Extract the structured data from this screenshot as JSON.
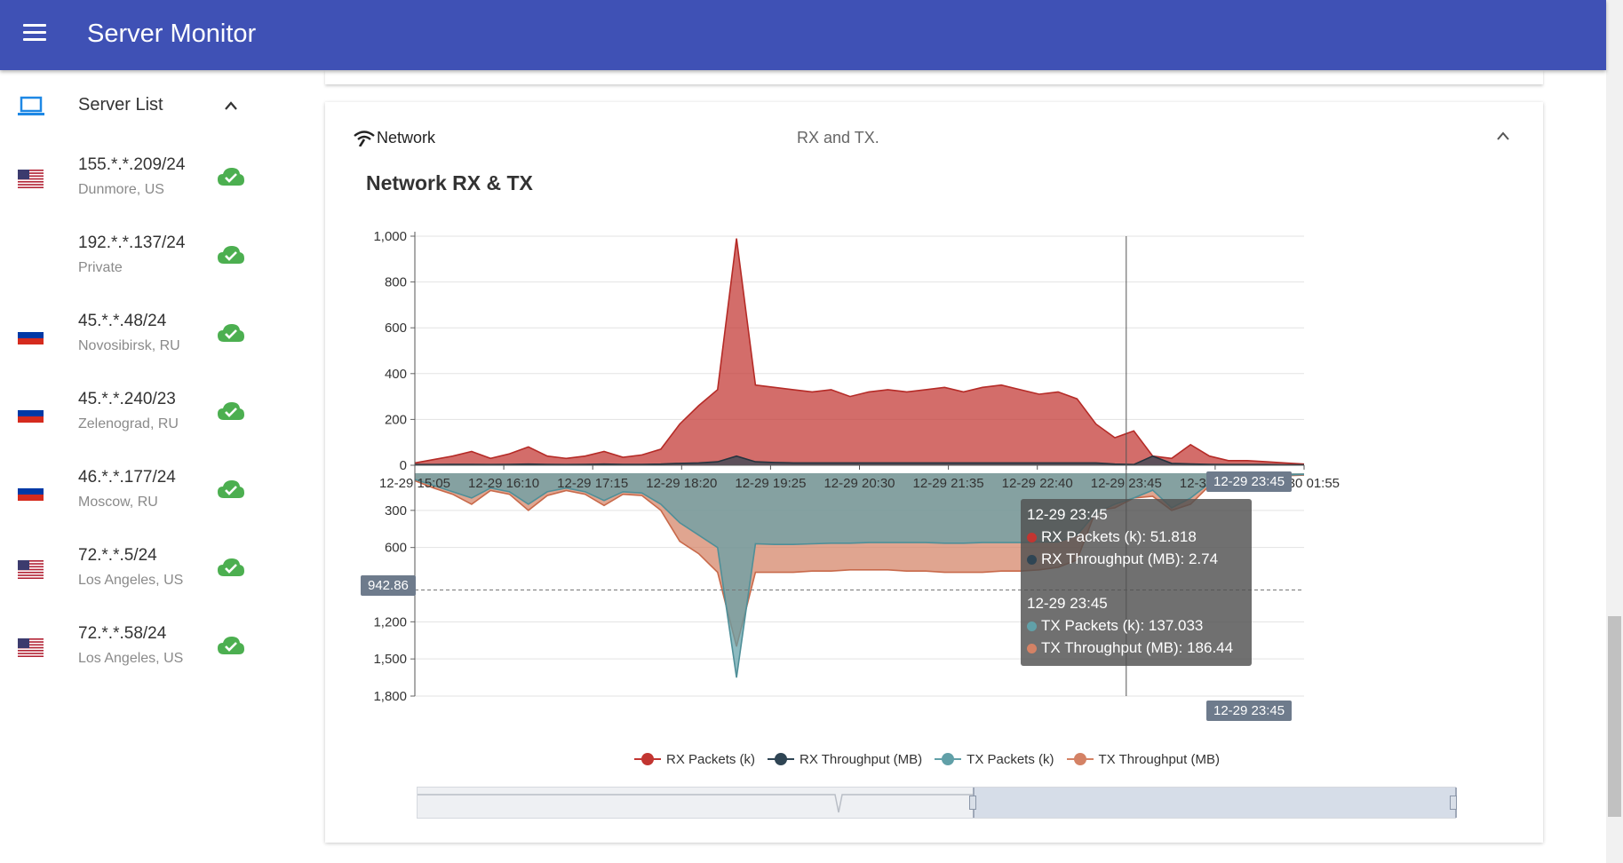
{
  "app": {
    "title": "Server Monitor"
  },
  "sidebar": {
    "header_label": "Server List",
    "servers": [
      {
        "ip": "155.*.*.209/24",
        "location": "Dunmore, US",
        "flag": "us",
        "status": "online"
      },
      {
        "ip": "192.*.*.137/24",
        "location": "Private",
        "flag": "none",
        "status": "online"
      },
      {
        "ip": "45.*.*.48/24",
        "location": "Novosibirsk, RU",
        "flag": "ru",
        "status": "online"
      },
      {
        "ip": "45.*.*.240/23",
        "location": "Zelenograd, RU",
        "flag": "ru",
        "status": "online"
      },
      {
        "ip": "46.*.*.177/24",
        "location": "Moscow, RU",
        "flag": "ru",
        "status": "online"
      },
      {
        "ip": "72.*.*.5/24",
        "location": "Los Angeles, US",
        "flag": "us",
        "status": "online"
      },
      {
        "ip": "72.*.*.58/24",
        "location": "Los Angeles, US",
        "flag": "us",
        "status": "online"
      }
    ]
  },
  "card": {
    "title": "Network",
    "subtitle": "RX and TX.",
    "chart_title": "Network RX & TX"
  },
  "tooltip": {
    "group1_time": "12-29 23:45",
    "rx_packets": "RX Packets (k): 51.818",
    "rx_throughput": "RX Throughput (MB): 2.74",
    "group2_time": "12-29 23:45",
    "tx_packets": "TX Packets (k): 137.033",
    "tx_throughput": "TX Throughput (MB): 186.44"
  },
  "axis_pointer": {
    "x_label_top": "12-29 23:45",
    "x_label_bottom": "12-29 23:45",
    "y_label": "942.86"
  },
  "legend": [
    "RX Packets (k)",
    "RX Throughput (MB)",
    "TX Packets (k)",
    "TX Throughput (MB)"
  ],
  "colors": {
    "accent": "#3f51b5",
    "rx_packets": "#c23531",
    "rx_throughput": "#2f4554",
    "tx_packets": "#61a0a8",
    "tx_throughput": "#d48265",
    "online": "#4caf50"
  },
  "chart_data": {
    "type": "area",
    "title": "Network RX & TX",
    "x": [
      "12-29 15:05",
      "12-29 16:10",
      "12-29 17:15",
      "12-29 18:20",
      "12-29 19:25",
      "12-29 20:30",
      "12-29 21:35",
      "12-29 22:40",
      "12-29 23:45",
      "12-30 00:50",
      "12-30 01:55"
    ],
    "x_tick_labels": [
      "12-29 15:05",
      "12-29 16:10",
      "12-29 17:15",
      "12-29 18:20",
      "12-29 19:25",
      "12-29 20:30",
      "12-29 21:35",
      "12-29 22:40",
      "12-29 23:45",
      "12-30 00:50",
      "12-30 01:55"
    ],
    "top_axis": {
      "ticks": [
        "1,000",
        "800",
        "600",
        "400",
        "200",
        "0"
      ],
      "ylim": [
        0,
        1000
      ]
    },
    "bottom_axis": {
      "ticks": [
        "300",
        "600",
        "1,200",
        "1,500",
        "1,800"
      ],
      "ylim": [
        0,
        1800
      ],
      "inverted": true
    },
    "series": [
      {
        "name": "RX Packets (k)",
        "axis": "top",
        "values": [
          10,
          25,
          40,
          60,
          30,
          50,
          80,
          40,
          30,
          40,
          60,
          35,
          45,
          70,
          180,
          260,
          330,
          990,
          350,
          340,
          330,
          320,
          330,
          300,
          320,
          330,
          320,
          330,
          340,
          320,
          340,
          350,
          330,
          310,
          320,
          290,
          180,
          120,
          150,
          40,
          30,
          90,
          40,
          20,
          20,
          15,
          10,
          5
        ]
      },
      {
        "name": "RX Throughput (MB)",
        "axis": "top",
        "values": [
          3,
          3,
          4,
          4,
          3,
          4,
          5,
          4,
          3,
          4,
          5,
          4,
          4,
          5,
          8,
          10,
          15,
          40,
          15,
          12,
          10,
          10,
          10,
          10,
          10,
          10,
          10,
          10,
          10,
          10,
          10,
          10,
          10,
          10,
          10,
          10,
          10,
          5,
          3,
          40,
          8,
          6,
          4,
          3,
          3,
          3,
          2,
          2
        ]
      },
      {
        "name": "TX Packets (k)",
        "axis": "bottom",
        "values": [
          50,
          100,
          150,
          200,
          120,
          150,
          250,
          150,
          120,
          150,
          220,
          150,
          160,
          250,
          400,
          500,
          600,
          1650,
          570,
          575,
          575,
          570,
          565,
          565,
          560,
          560,
          560,
          560,
          565,
          565,
          560,
          560,
          560,
          555,
          555,
          500,
          320,
          250,
          200,
          137,
          280,
          200,
          80,
          40,
          30,
          20,
          15,
          10
        ]
      },
      {
        "name": "TX Throughput (MB)",
        "axis": "bottom",
        "values": [
          60,
          120,
          170,
          250,
          140,
          170,
          300,
          180,
          140,
          170,
          260,
          170,
          180,
          300,
          550,
          650,
          800,
          1400,
          800,
          800,
          800,
          790,
          790,
          780,
          780,
          780,
          790,
          790,
          800,
          800,
          800,
          790,
          790,
          780,
          760,
          700,
          300,
          280,
          200,
          186.44,
          300,
          250,
          100,
          60,
          40,
          30,
          20,
          15
        ]
      }
    ]
  }
}
